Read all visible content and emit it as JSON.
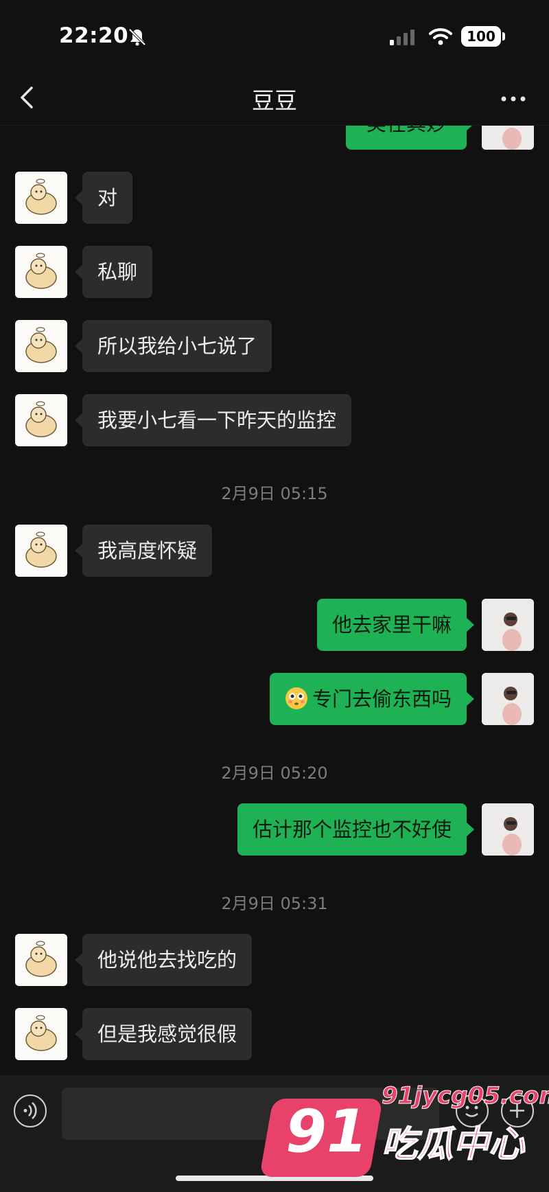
{
  "status_bar": {
    "time": "22:20",
    "battery": "100"
  },
  "nav": {
    "title": "豆豆"
  },
  "messages": [
    {
      "text": "美在其妙"
    },
    {
      "text": "对"
    },
    {
      "text": "私聊"
    },
    {
      "text": "所以我给小七说了"
    },
    {
      "text": "我要小七看一下昨天的监控"
    },
    {
      "timestamp": "2月9日 05:15"
    },
    {
      "text": "我高度怀疑"
    },
    {
      "text": "他去家里干嘛"
    },
    {
      "text": "专门去偷东西吗",
      "emoji": "flushed-face-emoji"
    },
    {
      "timestamp": "2月9日 05:20"
    },
    {
      "text": "估计那个监控也不好使"
    },
    {
      "timestamp": "2月9日 05:31"
    },
    {
      "text": "他说他去找吃的"
    },
    {
      "text": "但是我感觉很假"
    }
  ],
  "icons": {
    "back": "chevron-left-icon",
    "more": "more-dots-icon",
    "voice": "voice-icon",
    "emoji": "emoji-icon",
    "plus": "plus-icon"
  },
  "colors": {
    "background": "#111111",
    "incoming_bubble": "#2c2c2c",
    "outgoing_bubble": "#1fb254",
    "watermark": "#e8416a"
  },
  "watermark": {
    "number": "91",
    "domain": "91jycg05.com",
    "name": "吃瓜中心"
  }
}
